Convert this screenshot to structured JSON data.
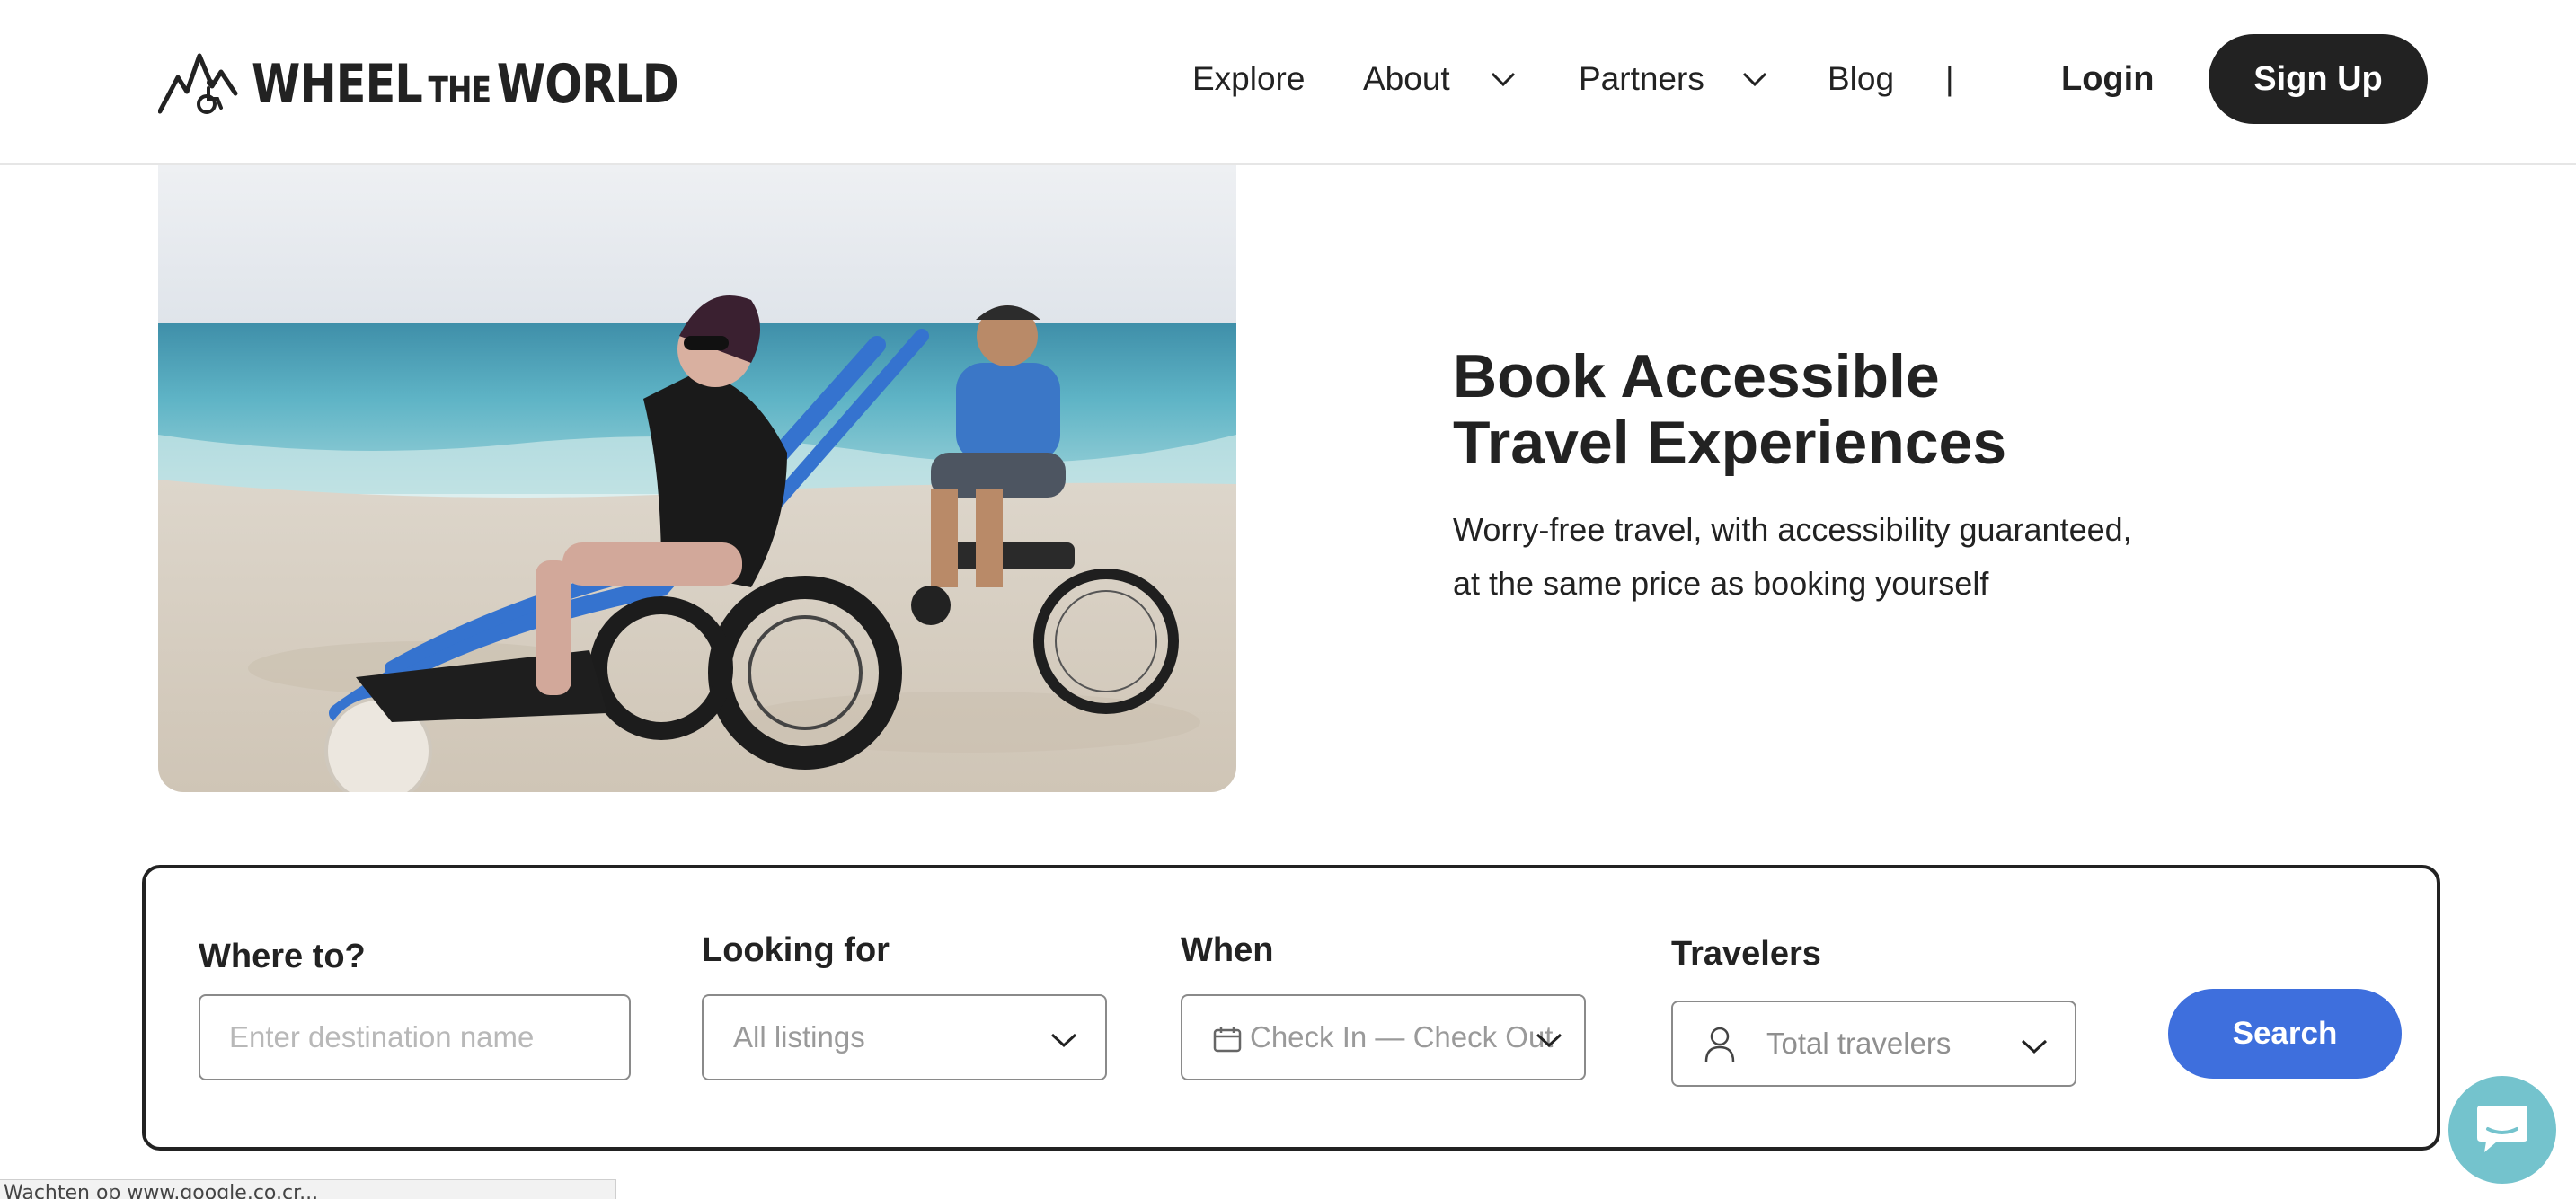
{
  "brand": {
    "logo_part1": "WHEEL",
    "logo_part2": "THE",
    "logo_part3": "WORLD"
  },
  "nav": {
    "explore": "Explore",
    "about": "About",
    "partners": "Partners",
    "blog": "Blog",
    "separator": "|",
    "login": "Login",
    "signup": "Sign Up"
  },
  "hero": {
    "title_line1": "Book Accessible",
    "title_line2": "Travel Experiences",
    "subtitle_line1": "Worry-free travel, with accessibility guaranteed,",
    "subtitle_line2": "at the same price as booking yourself"
  },
  "search": {
    "where_label": "Where to?",
    "where_placeholder": "Enter destination name",
    "looking_label": "Looking for",
    "looking_value": "All listings",
    "when_label": "When",
    "when_value": "Check In — Check Out",
    "travelers_label": "Travelers",
    "travelers_value": "Total travelers",
    "button": "Search"
  },
  "status_bar": "Wachten op www.google.co.cr...",
  "colors": {
    "primary_dark": "#222222",
    "search_blue": "#3e6fdd",
    "chat_teal": "#74c3cd"
  },
  "icons": [
    "chevron-down-icon",
    "calendar-icon",
    "user-icon",
    "chat-icon",
    "mountain-wheelchair-logo"
  ]
}
